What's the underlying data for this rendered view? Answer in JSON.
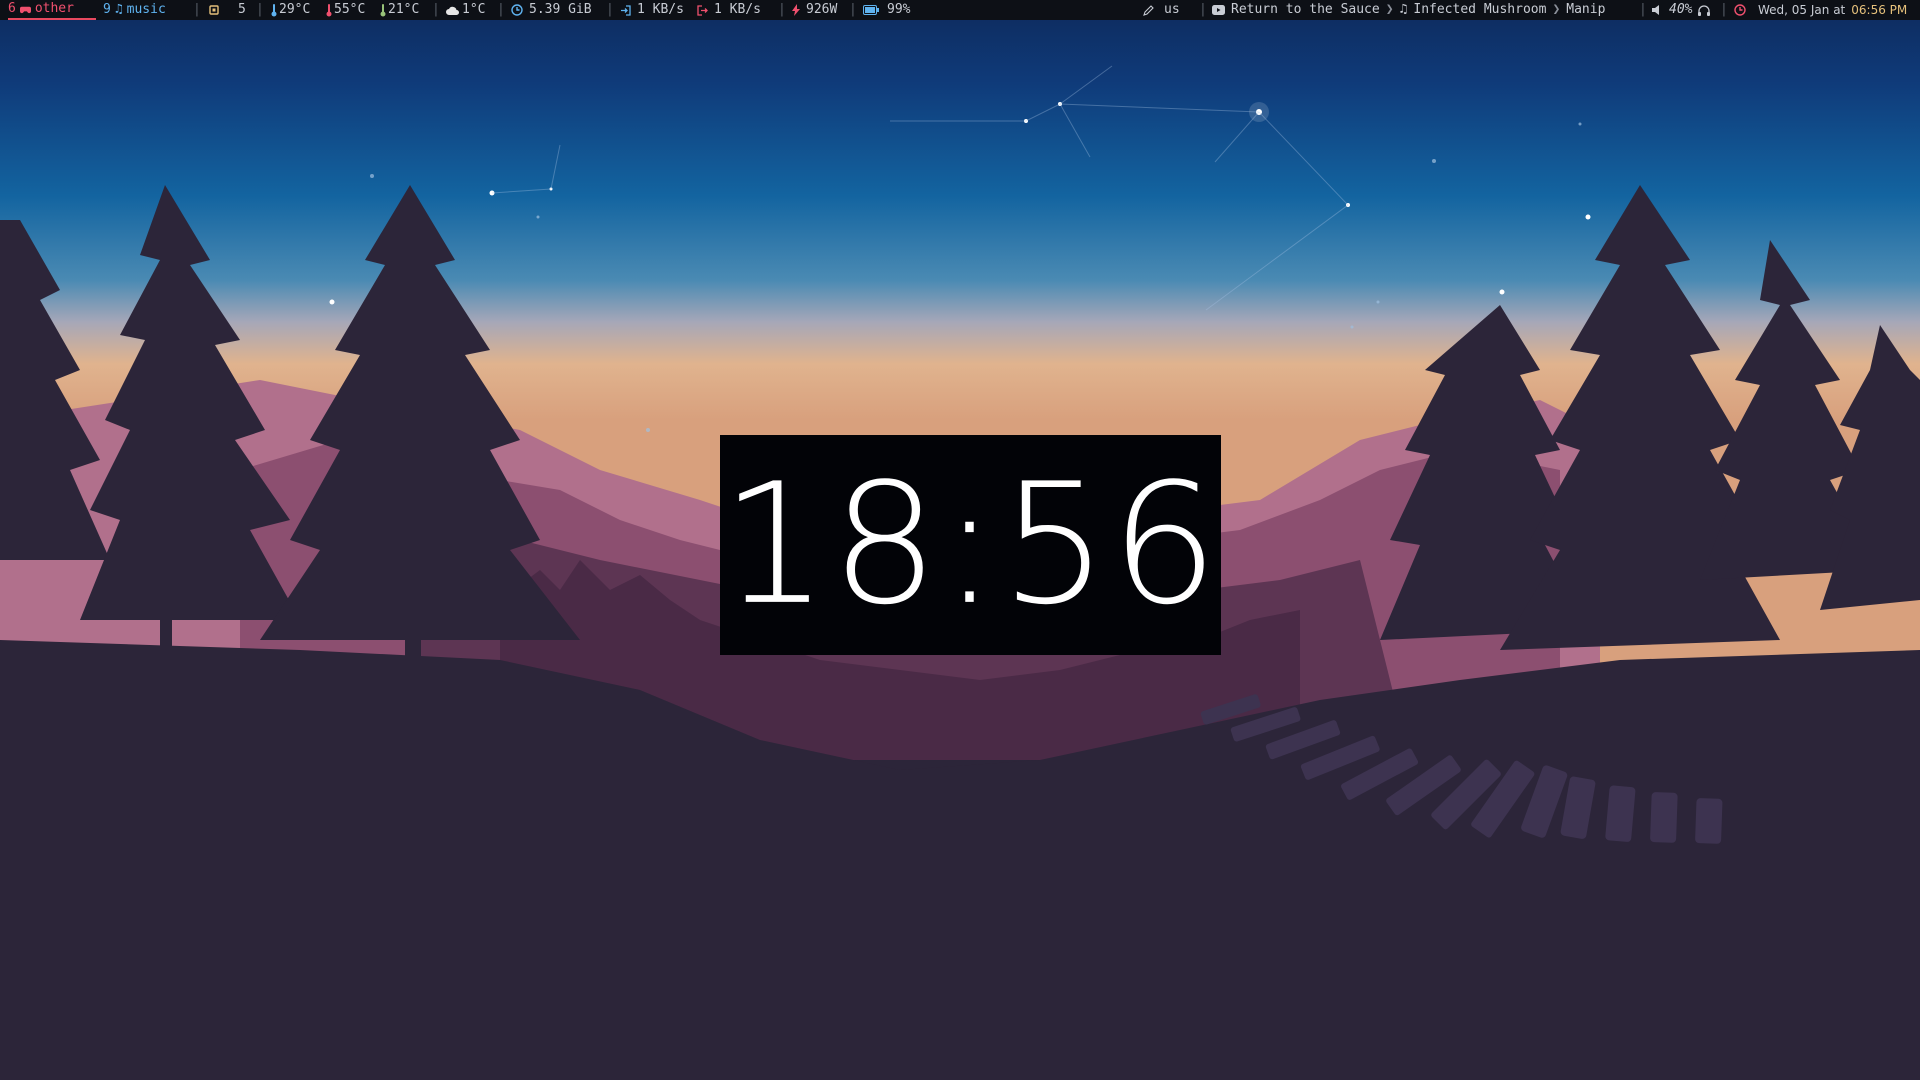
{
  "topbar": {
    "workspaces": [
      {
        "number": "6",
        "label": "other",
        "icon": "gamepad-icon",
        "active": true,
        "color": "#f0506e"
      },
      {
        "number": "9",
        "label": "music",
        "icon": "music-note-icon",
        "active": false,
        "color": "#5fb3f0"
      }
    ],
    "cpu": {
      "icon": "cpu-icon",
      "value": "5"
    },
    "temps": [
      {
        "icon": "thermometer-icon",
        "value": "29°C",
        "color": "#5fb3f0"
      },
      {
        "icon": "thermometer-icon",
        "value": "55°C",
        "color": "#f0506e"
      },
      {
        "icon": "thermometer-icon",
        "value": "21°C",
        "color": "#98c379"
      }
    ],
    "weather": {
      "icon": "cloud-icon",
      "value": "1°C"
    },
    "memory": {
      "icon": "memory-clock-icon",
      "value": "5.39 GiB"
    },
    "network_down": {
      "icon": "download-icon",
      "value": "1 KB/s"
    },
    "network_up": {
      "icon": "upload-icon",
      "value": "1 KB/s"
    },
    "power": {
      "icon": "bolt-icon",
      "value": "926W"
    },
    "battery": {
      "icon": "battery-icon",
      "value": "99%"
    },
    "keyboard": {
      "icon": "pencil-icon",
      "value": "us"
    },
    "media": {
      "icon": "youtube-icon",
      "title": "Return to the Sauce",
      "artist_icon": "music-note-icon",
      "artist": "Infected Mushroom",
      "album": "Manip"
    },
    "volume": {
      "icon": "speaker-icon",
      "value": "40%",
      "headphone_icon": "headphones-icon"
    },
    "datetime": {
      "icon": "clock-icon",
      "date": "Wed, 05 Jan at",
      "time": "06:56 PM"
    }
  },
  "clock": {
    "time": "18:56"
  },
  "colors": {
    "bar_bg": "#0d1016",
    "accent_red": "#f0506e",
    "accent_blue": "#5fb3f0",
    "accent_yellow": "#e5c07b",
    "sky_top": "#0f2f66",
    "ground": "#2c2539"
  }
}
